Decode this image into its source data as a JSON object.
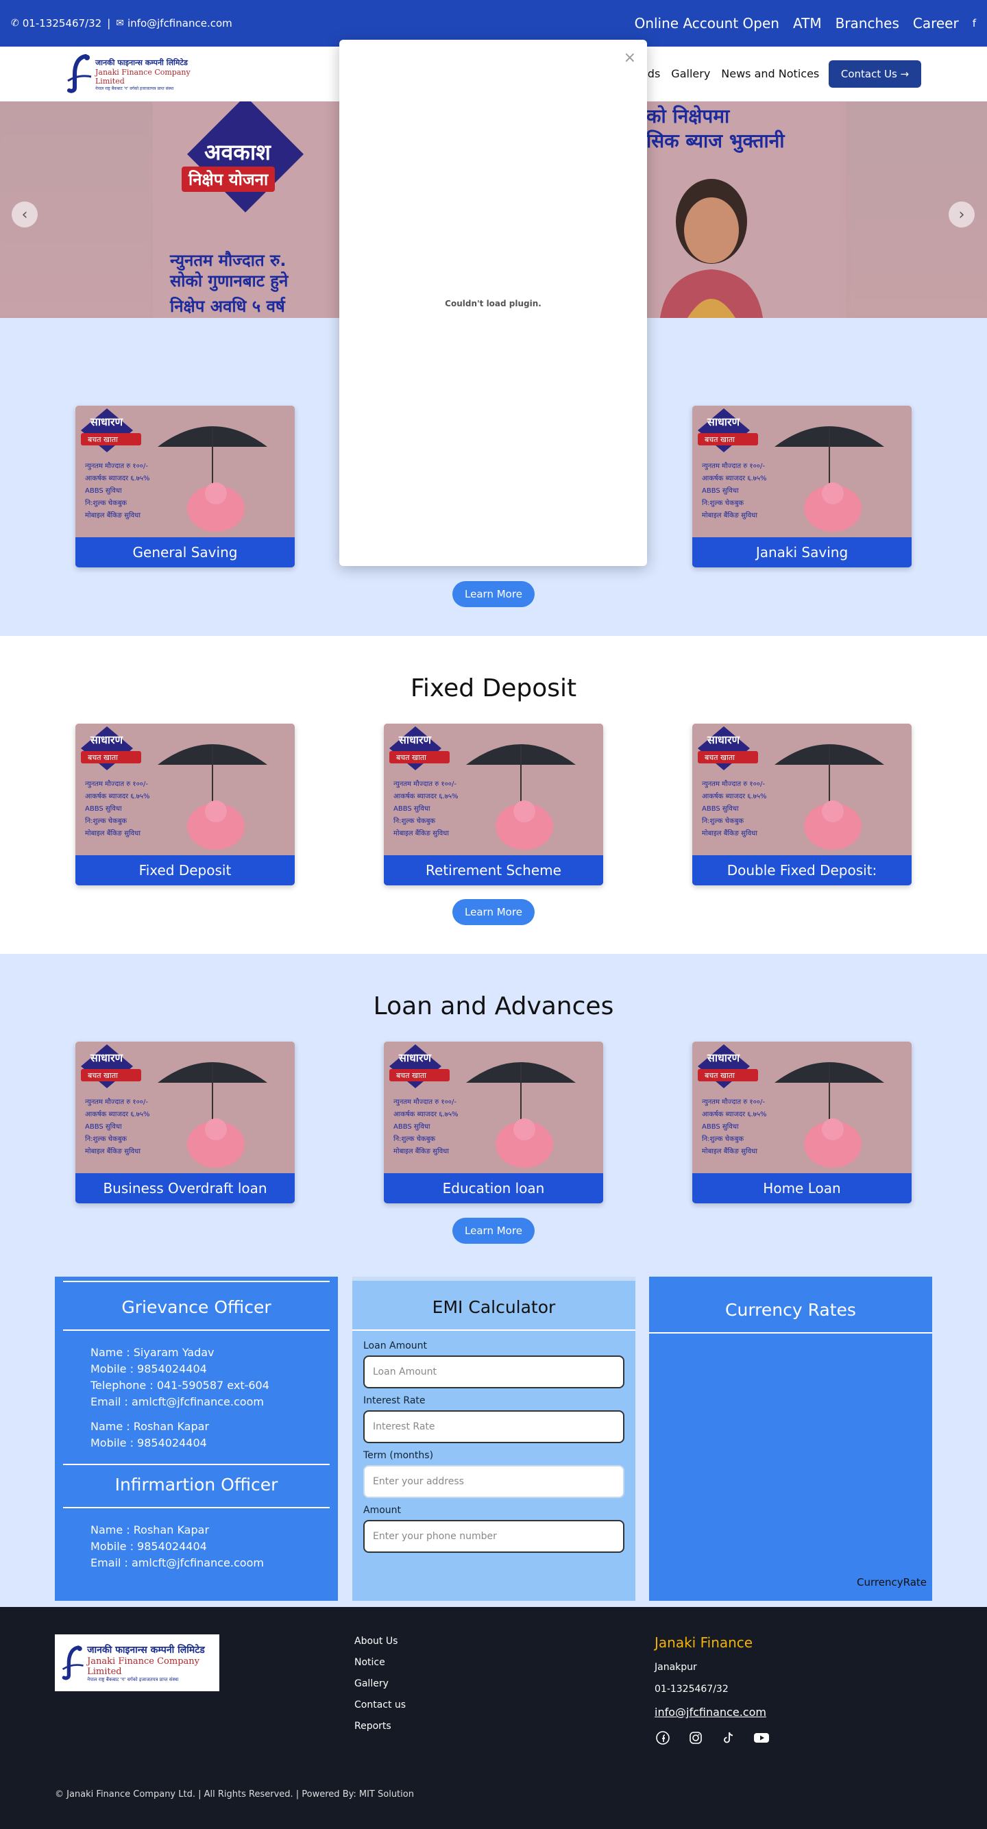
{
  "topbar": {
    "phone": "01-1325467/32",
    "separator": "|",
    "email": "info@jfcfinance.com",
    "links": [
      "Online Account Open",
      "ATM",
      "Branches",
      "Career"
    ],
    "facebook": "f"
  },
  "logo": {
    "line1": "जानकी फाइनान्स कम्पनी लिमिटेड",
    "line2": "Janaki Finance Company Limited",
    "line3": "नेपाल राष्ट्र बैंकबाट 'ग' वर्गको इजाजतपत्र प्राप्त संस्था"
  },
  "nav": {
    "items": [
      "ads",
      "Gallery",
      "News and Notices"
    ],
    "contact_label": "Contact Us →"
  },
  "slider": {
    "diamond_text": "अवकाश",
    "ribbon_text": "निक्षेप योजना",
    "line1": "न्युनतम मौज्दात रु.",
    "line2": "सोको गुणानबाट हुने",
    "line3": "निक्षेप अवधि ५ वर्ष",
    "head1": "को निक्षेपमा",
    "head2": "सिक ब्याज भुक्तानी",
    "prev": "‹",
    "next": "›"
  },
  "popup": {
    "close": "×",
    "message": "Couldn't load plugin."
  },
  "card_art": {
    "badge_top": "साधारण",
    "badge_sub": "बचत खाता",
    "features": [
      "न्युनतम मौज्दात रु १००/-",
      "आकर्षक ब्याजदर ६.७५%",
      "ABBS सुविधा",
      "नि:शुल्क चेकबुक",
      "मोबाइल बैंकिङ सुविधा"
    ]
  },
  "section1": {
    "cards": [
      "General Saving",
      "Janaki Saving"
    ],
    "learn_more": "Learn More"
  },
  "section2": {
    "title": "Fixed Deposit",
    "cards": [
      "Fixed Deposit",
      "Retirement Scheme",
      "Double Fixed Deposit:"
    ],
    "learn_more": "Learn More"
  },
  "section3": {
    "title": "Loan and Advances",
    "cards": [
      "Business Overdraft loan",
      "Education loan",
      "Home Loan"
    ],
    "learn_more": "Learn More"
  },
  "grievance": {
    "title": "Grievance Officer",
    "lines": [
      "Name : Siyaram Yadav",
      "Mobile : 9854024404",
      "Telephone : 041-590587 ext-604",
      "Email : amlcft@jfcfinance.coom"
    ],
    "lines2": [
      "Name : Roshan Kapar",
      "Mobile : 9854024404"
    ],
    "info_title": "Infirmartion Officer",
    "info_lines": [
      "Name : Roshan Kapar",
      "Mobile : 9854024404",
      "Email : amlcft@jfcfinance.coom"
    ]
  },
  "emi": {
    "title": "EMI Calculator",
    "fields": [
      {
        "label": "Loan Amount",
        "placeholder": "Loan Amount"
      },
      {
        "label": "Interest Rate",
        "placeholder": "Interest Rate"
      },
      {
        "label": "Term (months)",
        "placeholder": "Enter your address"
      },
      {
        "label": "Amount",
        "placeholder": "Enter your phone number"
      }
    ]
  },
  "currency": {
    "title": "Currency Rates",
    "footer": "CurrencyRate"
  },
  "footer": {
    "links": [
      "About Us",
      "Notice",
      "Gallery",
      "Contact us",
      "Reports"
    ],
    "company": "Janaki Finance",
    "address": "Janakpur",
    "phone": "01-1325467/32",
    "email": "info@jfcfinance.com",
    "copyright": "© Janaki Finance Company Ltd. | All Rights Reserved. | Powered By: MIT Solution"
  },
  "colors": {
    "brand_blue": "#1f47b8",
    "card_blue": "#1f52d6",
    "accent_button": "#3a82ee",
    "section_tint": "#dbe7ff",
    "footer_bg": "#151a24",
    "footer_title": "#f5b301"
  }
}
